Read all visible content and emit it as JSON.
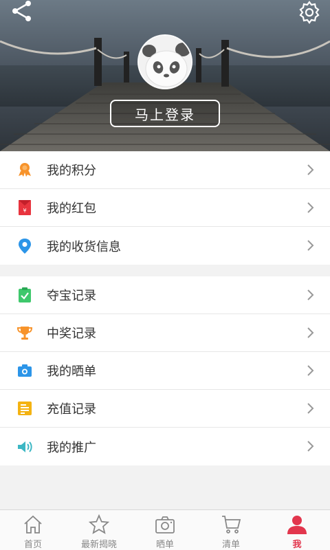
{
  "header": {
    "login_label": "马上登录"
  },
  "menu_group_1": [
    {
      "label": "我的积分",
      "icon": "medal-icon"
    },
    {
      "label": "我的红包",
      "icon": "red-envelope-icon"
    },
    {
      "label": "我的收货信息",
      "icon": "location-pin-icon"
    }
  ],
  "menu_group_2": [
    {
      "label": "夺宝记录",
      "icon": "clipboard-check-icon"
    },
    {
      "label": "中奖记录",
      "icon": "trophy-icon"
    },
    {
      "label": "我的晒单",
      "icon": "camera-icon"
    },
    {
      "label": "充值记录",
      "icon": "document-icon"
    },
    {
      "label": "我的推广",
      "icon": "speaker-icon"
    }
  ],
  "tabs": [
    {
      "label": "首页",
      "icon": "home-icon"
    },
    {
      "label": "最新揭晓",
      "icon": "star-icon"
    },
    {
      "label": "晒单",
      "icon": "camera-icon"
    },
    {
      "label": "清单",
      "icon": "cart-icon"
    },
    {
      "label": "我",
      "icon": "user-icon",
      "active": true
    }
  ],
  "colors": {
    "accent": "#e2364d",
    "orange": "#f7932b",
    "red": "#e8343e",
    "blue": "#2c95e8",
    "green": "#3fc86c",
    "yellow": "#f4b312",
    "teal": "#3cb7c4"
  }
}
